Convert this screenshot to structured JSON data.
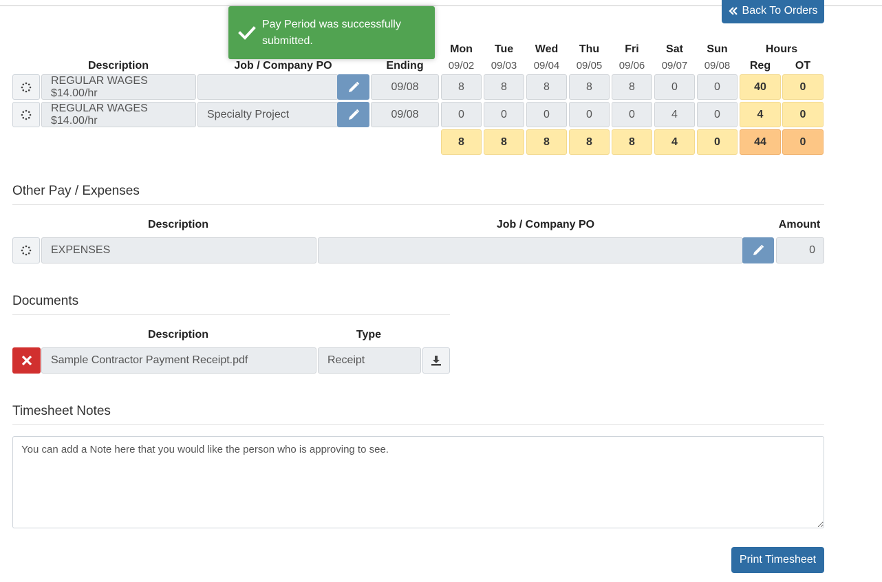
{
  "header": {
    "back_label": "Back To Orders"
  },
  "toast": {
    "message": "Pay Period was successfully submitted."
  },
  "timesheet": {
    "columns": {
      "description": "Description",
      "job_po": "Job / Company PO",
      "ending": "Ending",
      "hours": "Hours",
      "reg": "Reg",
      "ot": "OT"
    },
    "days": [
      {
        "name": "Mon",
        "date": "09/02"
      },
      {
        "name": "Tue",
        "date": "09/03"
      },
      {
        "name": "Wed",
        "date": "09/04"
      },
      {
        "name": "Thu",
        "date": "09/05"
      },
      {
        "name": "Fri",
        "date": "09/06"
      },
      {
        "name": "Sat",
        "date": "09/07"
      },
      {
        "name": "Sun",
        "date": "09/08"
      }
    ],
    "rows": [
      {
        "description": "REGULAR WAGES $14.00/hr",
        "job_po": "",
        "ending": "09/08",
        "hours": [
          "8",
          "8",
          "8",
          "8",
          "8",
          "0",
          "0"
        ],
        "reg": "40",
        "ot": "0"
      },
      {
        "description": "REGULAR WAGES $14.00/hr",
        "job_po": "Specialty Project",
        "ending": "09/08",
        "hours": [
          "0",
          "0",
          "0",
          "0",
          "0",
          "4",
          "0"
        ],
        "reg": "4",
        "ot": "0"
      }
    ],
    "totals": {
      "days": [
        "8",
        "8",
        "8",
        "8",
        "8",
        "4",
        "0"
      ],
      "reg": "44",
      "ot": "0"
    }
  },
  "other_pay": {
    "title": "Other Pay / Expenses",
    "columns": {
      "description": "Description",
      "job_po": "Job / Company PO",
      "amount": "Amount"
    },
    "rows": [
      {
        "description": "EXPENSES",
        "job_po": "",
        "amount": "0"
      }
    ]
  },
  "documents": {
    "title": "Documents",
    "columns": {
      "description": "Description",
      "type": "Type"
    },
    "rows": [
      {
        "description": "Sample Contractor Payment Receipt.pdf",
        "type": "Receipt"
      }
    ]
  },
  "notes": {
    "title": "Timesheet Notes",
    "value": "You can add a Note here that you would like the person who is approving to see."
  },
  "footer": {
    "print_label": "Print Timesheet"
  },
  "colors": {
    "primary": "#2e6da4",
    "success": "#51a351",
    "danger": "#d1302f",
    "hours_total": "#ffeaa7",
    "grand_total": "#fdc685"
  },
  "icons": {
    "back": "double-chevron-left-icon",
    "toast": "checkmark-icon",
    "row_status": "spinner-icon",
    "edit": "pencil-icon",
    "delete": "close-icon",
    "download": "download-icon"
  }
}
